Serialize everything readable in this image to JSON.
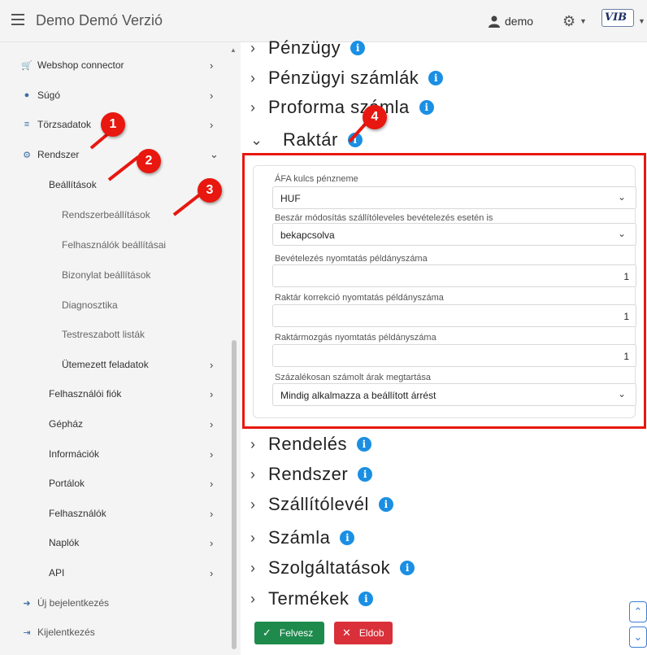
{
  "header": {
    "title": "Demo Demó Verzió",
    "user": "demo",
    "logo_text": "VIB"
  },
  "sidebar": {
    "items": [
      {
        "label": "Webshop connector",
        "icon": "cart-icon"
      },
      {
        "label": "Súgó",
        "icon": "question-circle-icon"
      },
      {
        "label": "Törzsadatok",
        "icon": "database-icon"
      },
      {
        "label": "Rendszer",
        "icon": "cogs-icon"
      },
      {
        "label": "Beállítások"
      },
      {
        "label": "Rendszerbeállítások"
      },
      {
        "label": "Felhasználók beállításai"
      },
      {
        "label": "Bizonylat beállítások"
      },
      {
        "label": "Diagnosztika"
      },
      {
        "label": "Testreszabott listák"
      },
      {
        "label": "Ütemezett feladatok"
      },
      {
        "label": "Felhasználói fiók"
      },
      {
        "label": "Gépház"
      },
      {
        "label": "Információk"
      },
      {
        "label": "Portálok"
      },
      {
        "label": "Felhasználók"
      },
      {
        "label": "Naplók"
      },
      {
        "label": "API"
      },
      {
        "label": "Új bejelentkezés",
        "icon": "sign-in-icon"
      },
      {
        "label": "Kijelentkezés",
        "icon": "sign-out-icon"
      }
    ]
  },
  "badges": [
    "1",
    "2",
    "3",
    "4"
  ],
  "sections": [
    {
      "label": "Pénzügy"
    },
    {
      "label": "Pénzügyi számlák"
    },
    {
      "label": "Proforma számla"
    },
    {
      "label": "Raktár",
      "expanded": true
    },
    {
      "label": "Rendelés"
    },
    {
      "label": "Rendszer"
    },
    {
      "label": "Szállítólevél"
    },
    {
      "label": "Számla"
    },
    {
      "label": "Szolgáltatások"
    },
    {
      "label": "Termékek"
    }
  ],
  "raktar_fields": [
    {
      "label": "ÁFA kulcs pénzneme",
      "value": "HUF",
      "type": "select"
    },
    {
      "label": "Beszár módosítás szállítóleveles bevételezés esetén is",
      "value": "bekapcsolva",
      "type": "select"
    },
    {
      "label": "Bevételezés nyomtatás példányszáma",
      "value": "1",
      "type": "number"
    },
    {
      "label": "Raktár korrekció nyomtatás példányszáma",
      "value": "1",
      "type": "number"
    },
    {
      "label": "Raktármozgás nyomtatás példányszáma",
      "value": "1",
      "type": "number"
    },
    {
      "label": "Százalékosan számolt árak megtartása",
      "value": "Mindig alkalmazza a beállított árrést",
      "type": "select"
    }
  ],
  "buttons": {
    "save": "Felvesz",
    "discard": "Eldob"
  },
  "colors": {
    "highlight": "#e8170f",
    "info": "#1a8fe3",
    "save": "#1e8a4c",
    "discard": "#d9303a"
  }
}
